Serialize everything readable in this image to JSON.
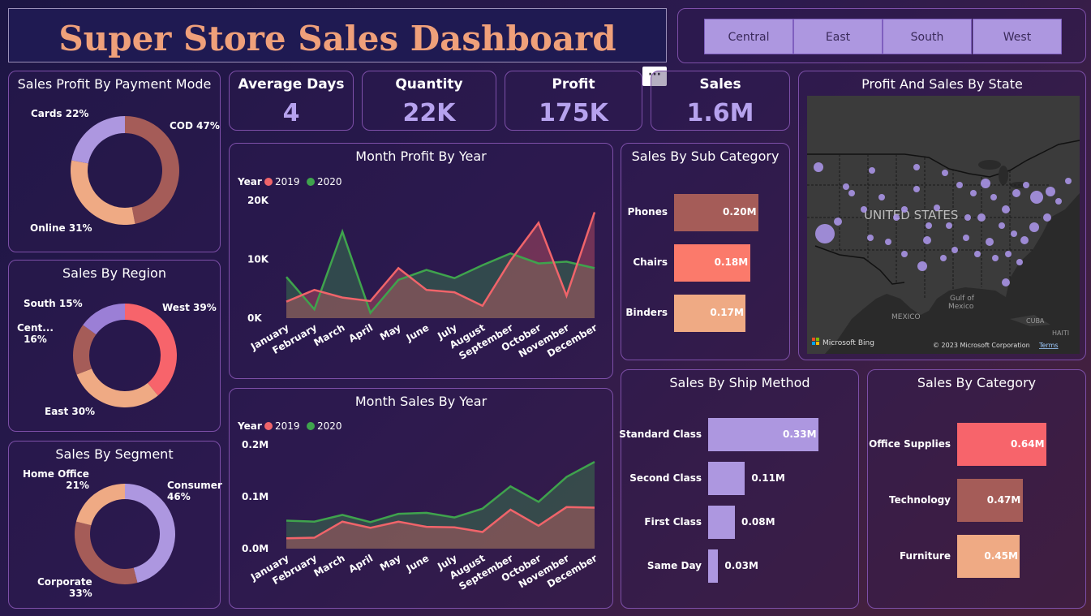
{
  "title": "Super Store Sales Dashboard",
  "more_button": "···",
  "region_slicer": [
    "Central",
    "East",
    "South",
    "West"
  ],
  "kpis": [
    {
      "label": "Average Days",
      "value": "4"
    },
    {
      "label": "Quantity",
      "value": "22K"
    },
    {
      "label": "Profit",
      "value": "175K"
    },
    {
      "label": "Sales",
      "value": "1.6M"
    }
  ],
  "colors": {
    "lavender": "#ad97e0",
    "brown": "#a55c58",
    "peach": "#efaa84",
    "coral": "#f7646b",
    "salmon": "#fb7a6b",
    "green": "#3fa34d",
    "red_line": "#f0646a"
  },
  "chart_data": [
    {
      "type": "pie",
      "donut": true,
      "title": "Sales Profit By Payment Mode",
      "categories": [
        "COD",
        "Online",
        "Cards"
      ],
      "values": [
        47,
        31,
        22
      ],
      "labels": [
        "COD 47%",
        "Online 31%",
        "Cards 22%"
      ],
      "colors": [
        "#a55c58",
        "#efaa84",
        "#ad97e0"
      ]
    },
    {
      "type": "pie",
      "donut": true,
      "title": "Sales By Region",
      "categories": [
        "West",
        "East",
        "Central",
        "South"
      ],
      "values": [
        39,
        30,
        16,
        15
      ],
      "labels": [
        "West 39%",
        "East 30%",
        "Cent...\n16%",
        "South 15%"
      ],
      "colors": [
        "#f7646b",
        "#efaa84",
        "#a55c58",
        "#9b7fd6"
      ]
    },
    {
      "type": "pie",
      "donut": true,
      "title": "Sales By Segment",
      "categories": [
        "Consumer",
        "Corporate",
        "Home Office"
      ],
      "values": [
        46,
        33,
        21
      ],
      "labels": [
        "Consumer\n46%",
        "Corporate\n33%",
        "Home Office\n21%"
      ],
      "colors": [
        "#ad97e0",
        "#a55c58",
        "#efaa84"
      ]
    },
    {
      "type": "area",
      "title": "Month Profit By Year",
      "legend_title": "Year",
      "categories": [
        "January",
        "February",
        "March",
        "April",
        "May",
        "June",
        "July",
        "August",
        "September",
        "October",
        "November",
        "December"
      ],
      "series": [
        {
          "name": "2019",
          "color": "#f0646a",
          "values": [
            2800,
            4800,
            3500,
            2900,
            8500,
            4800,
            4400,
            2100,
            9800,
            16200,
            3800,
            18000
          ]
        },
        {
          "name": "2020",
          "color": "#3fa34d",
          "values": [
            7000,
            1500,
            14700,
            900,
            6500,
            8200,
            6800,
            9000,
            11000,
            9300,
            9600,
            8500
          ]
        }
      ],
      "yticks": [
        "0K",
        "10K",
        "20K"
      ],
      "ylim": [
        0,
        20000
      ]
    },
    {
      "type": "area",
      "title": "Month Sales By Year",
      "legend_title": "Year",
      "categories": [
        "January",
        "February",
        "March",
        "April",
        "May",
        "June",
        "July",
        "August",
        "September",
        "October",
        "November",
        "December"
      ],
      "series": [
        {
          "name": "2019",
          "color": "#f0646a",
          "values": [
            0.02,
            0.021,
            0.052,
            0.04,
            0.052,
            0.042,
            0.041,
            0.032,
            0.075,
            0.044,
            0.08,
            0.079
          ]
        },
        {
          "name": "2020",
          "color": "#3fa34d",
          "values": [
            0.054,
            0.052,
            0.065,
            0.051,
            0.067,
            0.069,
            0.06,
            0.077,
            0.12,
            0.09,
            0.138,
            0.167
          ]
        }
      ],
      "yticks": [
        "0.0M",
        "0.1M",
        "0.2M"
      ],
      "ylim": [
        0,
        0.2
      ]
    },
    {
      "type": "bar",
      "orientation": "horizontal",
      "title": "Sales By Sub Category",
      "categories": [
        "Phones",
        "Chairs",
        "Binders"
      ],
      "values": [
        0.2,
        0.18,
        0.17
      ],
      "value_labels": [
        "0.20M",
        "0.18M",
        "0.17M"
      ],
      "colors": [
        "#a55c58",
        "#fb7a6b",
        "#efaa84"
      ]
    },
    {
      "type": "bar",
      "orientation": "horizontal",
      "title": "Sales By Ship Method",
      "categories": [
        "Standard Class",
        "Second Class",
        "First Class",
        "Same Day"
      ],
      "values": [
        0.33,
        0.11,
        0.08,
        0.03
      ],
      "value_labels": [
        "0.33M",
        "0.11M",
        "0.08M",
        "0.03M"
      ],
      "colors": [
        "#ad97e0",
        "#ad97e0",
        "#ad97e0",
        "#ad97e0"
      ]
    },
    {
      "type": "bar",
      "orientation": "horizontal",
      "title": "Sales By Category",
      "categories": [
        "Office Supplies",
        "Technology",
        "Furniture"
      ],
      "values": [
        0.64,
        0.47,
        0.45
      ],
      "value_labels": [
        "0.64M",
        "0.47M",
        "0.45M"
      ],
      "colors": [
        "#f7646b",
        "#a55c58",
        "#efaa84"
      ]
    }
  ],
  "map": {
    "title": "Profit And Sales By State",
    "country_label": "UNITED STATES",
    "gulf_label": "Gulf of Mexico",
    "mexico_label": "MEXICO",
    "cuba_label": "CUBA",
    "haiti_label": "HAITI",
    "bing_label": "Microsoft Bing",
    "copyright": "© 2023 Microsoft Corporation",
    "terms": "Terms"
  }
}
